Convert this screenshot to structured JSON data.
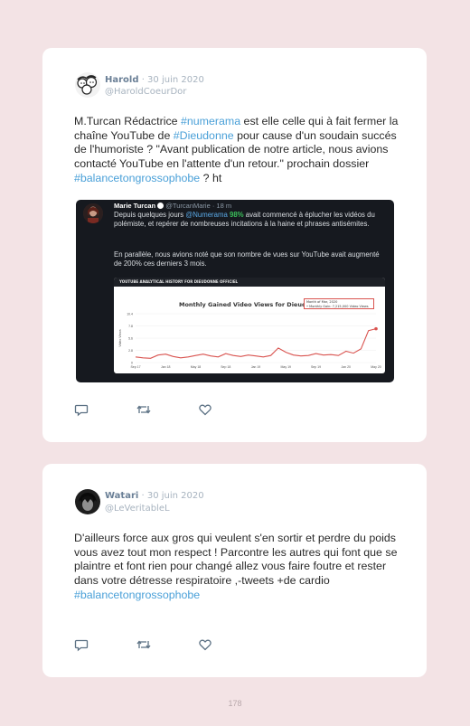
{
  "tweets": [
    {
      "name": "Harold",
      "date": "· 30 juin 2020",
      "handle": "@HaroldCoeurDor",
      "text": {
        "p1": "M.Turcan Rédactrice ",
        "t1": "#numerama",
        "p2": " est elle celle qui à fait fermer la chaîne YouTube de ",
        "t2": "#Dieudonne",
        "p3": " pour cause d'un soudain succés de l'humoriste ? \"Avant publication de notre article, nous avions contacté YouTube en l'attente d'un retour.\" prochain dossier ",
        "t3": "#balancetongrossophobe",
        "p4": " ? ht"
      },
      "embed": {
        "author": "Marie Turcan",
        "handle": "@TurcanMarie · 18 m",
        "line1_pre": "Depuis quelques jours ",
        "line1_tag": "@Numerama",
        "line1_pct": "98%",
        "line1_post": " avait commencé à éplucher les vidéos du polémiste, et repérer de nombreuses incitations à la haine et phrases antisémites.",
        "line2": "En parallèle, nous avions noté que son nombre de vues sur YouTube avait augmenté de 200% ces derniers 3 mois.",
        "chart_header": "YOUTUBE ANALYTICAL HISTORY FOR DIEUDONNE OFFICIEL",
        "chart_title": "Monthly Gained Video Views for Dieudonné Offi",
        "tooltip_line1": "Month of Mar, 2020",
        "tooltip_line2": "• Monthly Gain: 7,215,000 Video Views",
        "ylabel": "Video Views",
        "y_ticks": [
          "10.4",
          "7.8",
          "5.6",
          "2.8",
          "0"
        ],
        "x_ticks": [
          "Sep 17",
          "Jan 18",
          "May 18",
          "Sep 18",
          "Jan 19",
          "May 19",
          "Sep 19",
          "Jan 20",
          "May 20"
        ]
      }
    },
    {
      "name": "Watari",
      "date": "· 30 juin 2020",
      "handle": "@LeVeritableL",
      "text": {
        "p1": "D'ailleurs force aux gros qui veulent s'en sortir et perdre du poids vous avez tout mon respect ! Parcontre les autres qui font que se plaintre et font rien pour changé allez vous faire foutre et rester dans votre détresse respiratoire ,-tweets +de cardio",
        "t1": "#balancetongrossophobe"
      }
    }
  ],
  "chart_data": {
    "type": "line",
    "title": "Monthly Gained Video Views for Dieudonné Offi",
    "xlabel": "",
    "ylabel": "Video Views",
    "x": [
      "Sep 17",
      "Oct 17",
      "Nov 17",
      "Dec 17",
      "Jan 18",
      "Feb 18",
      "Mar 18",
      "Apr 18",
      "May 18",
      "Jun 18",
      "Jul 18",
      "Aug 18",
      "Sep 18",
      "Oct 18",
      "Nov 18",
      "Dec 18",
      "Jan 19",
      "Feb 19",
      "Mar 19",
      "Apr 19",
      "May 19",
      "Jun 19",
      "Jul 19",
      "Aug 19",
      "Sep 19",
      "Oct 19",
      "Nov 19",
      "Dec 19",
      "Jan 20",
      "Feb 20",
      "Mar 20",
      "Apr 20",
      "May 20"
    ],
    "series": [
      {
        "values": [
          1.2,
          1.0,
          0.9,
          1.6,
          1.8,
          1.3,
          1.0,
          1.2,
          1.5,
          1.8,
          1.4,
          1.2,
          1.9,
          1.5,
          1.3,
          1.6,
          1.4,
          1.2,
          1.5,
          3.1,
          2.2,
          1.6,
          1.4,
          1.5,
          1.9,
          1.6,
          1.7,
          1.5,
          2.4,
          2.0,
          2.9,
          6.8,
          7.2
        ]
      }
    ],
    "ylim": [
      0,
      10.4
    ],
    "highlight": {
      "x": "Mar 2020",
      "label": "7,215,000 Video Views"
    }
  },
  "footer": {
    "page_number": "178"
  },
  "icons": [
    "reply-icon",
    "retweet-icon",
    "like-icon"
  ],
  "colors": {
    "hashtag": "#4aa0d8",
    "background": "#f3e3e5",
    "card": "#ffffff",
    "chart_line": "#d9534f"
  }
}
